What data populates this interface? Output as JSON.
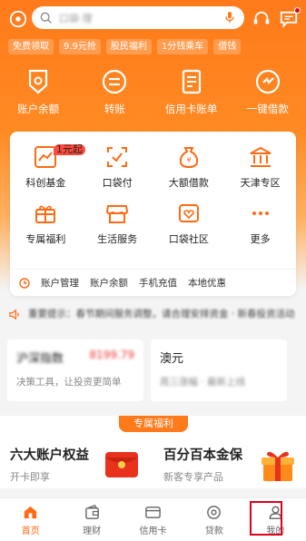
{
  "search": {
    "placeholder": "口袋·理"
  },
  "promo_tags": [
    "免费领取",
    "9.9元抢",
    "股民福利",
    "1分钱乘车",
    "借钱"
  ],
  "quick_actions": [
    {
      "label": "账户余额",
      "icon": "wallet-icon"
    },
    {
      "label": "转账",
      "icon": "transfer-icon"
    },
    {
      "label": "信用卡账单",
      "icon": "bill-icon"
    },
    {
      "label": "一键借款",
      "icon": "loan-icon"
    }
  ],
  "services": [
    {
      "label": "科创基金",
      "icon": "chart-icon",
      "badge": "1元起"
    },
    {
      "label": "口袋付",
      "icon": "scan-icon"
    },
    {
      "label": "大额借款",
      "icon": "money-bag-icon"
    },
    {
      "label": "天津专区",
      "icon": "building-icon"
    },
    {
      "label": "专属福利",
      "icon": "gift-icon"
    },
    {
      "label": "生活服务",
      "icon": "store-icon"
    },
    {
      "label": "口袋社区",
      "icon": "community-icon"
    },
    {
      "label": "更多",
      "icon": "more-icon"
    }
  ],
  "card_links": [
    "账户管理",
    "账户余额",
    "手机充值",
    "本地优惠"
  ],
  "notice": {
    "text": "重要提示：春节期间服务调整，请合理安排资金 · 新春投资活动"
  },
  "market": [
    {
      "title": "沪深指数",
      "value": "8199.79",
      "subtitle": "决策工具，让投资更简单"
    },
    {
      "title": "澳元",
      "value": "",
      "subtitle": "周三涨幅 · 最新上线"
    }
  ],
  "welfare": {
    "header": "专属福利",
    "left": {
      "title": "六大账户权益",
      "subtitle": "开卡即享"
    },
    "right": {
      "title": "百分百本金保",
      "subtitle": "新客专享产品"
    }
  },
  "bottom_nav": [
    {
      "label": "首页",
      "icon": "home-icon",
      "active": true
    },
    {
      "label": "理财",
      "icon": "wealth-icon",
      "active": false
    },
    {
      "label": "信用卡",
      "icon": "credit-card-icon",
      "active": false
    },
    {
      "label": "贷款",
      "icon": "loan-icon",
      "active": false
    },
    {
      "label": "我的",
      "icon": "user-icon",
      "active": false
    }
  ],
  "colors": {
    "brand": "#ff7a1a",
    "active": "#ff6a13",
    "highlight": "#e0001b"
  }
}
